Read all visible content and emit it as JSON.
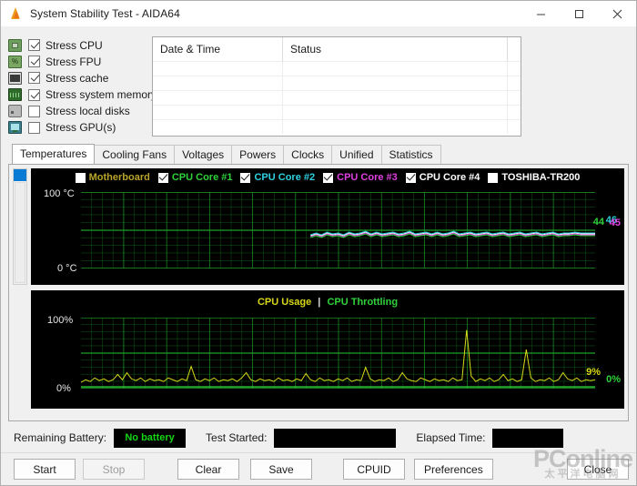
{
  "window": {
    "title": "System Stability Test - AIDA64",
    "icon": "flame-icon",
    "minimize": "–",
    "maximize": "□",
    "close": "✕"
  },
  "stress_options": [
    {
      "label": "Stress CPU",
      "checked": true,
      "icon": "cpu-icon"
    },
    {
      "label": "Stress FPU",
      "checked": true,
      "icon": "fpu-icon"
    },
    {
      "label": "Stress cache",
      "checked": true,
      "icon": "cache-icon"
    },
    {
      "label": "Stress system memory",
      "checked": true,
      "icon": "memory-icon"
    },
    {
      "label": "Stress local disks",
      "checked": false,
      "icon": "disk-icon"
    },
    {
      "label": "Stress GPU(s)",
      "checked": false,
      "icon": "gpu-icon"
    }
  ],
  "log": {
    "columns": [
      "Date & Time",
      "Status"
    ],
    "rows": []
  },
  "tabs": [
    {
      "label": "Temperatures",
      "active": true
    },
    {
      "label": "Cooling Fans",
      "active": false
    },
    {
      "label": "Voltages",
      "active": false
    },
    {
      "label": "Powers",
      "active": false
    },
    {
      "label": "Clocks",
      "active": false
    },
    {
      "label": "Unified",
      "active": false
    },
    {
      "label": "Statistics",
      "active": false
    }
  ],
  "temperature_chart": {
    "legend": [
      {
        "label": "Motherboard",
        "color": "#b8a42a",
        "checked": false
      },
      {
        "label": "CPU Core #1",
        "color": "#2fd23a",
        "checked": true
      },
      {
        "label": "CPU Core #2",
        "color": "#2fd2e0",
        "checked": true
      },
      {
        "label": "CPU Core #3",
        "color": "#e040e0",
        "checked": true
      },
      {
        "label": "CPU Core #4",
        "color": "#ffffff",
        "checked": true
      },
      {
        "label": "TOSHIBA-TR200",
        "color": "#ffffff",
        "checked": false
      }
    ],
    "y_top": "100 °C",
    "y_bottom": "0 °C",
    "readouts": [
      {
        "value": "44",
        "color": "#2fd23a"
      },
      {
        "value": "46",
        "color": "#2fd2e0"
      },
      {
        "value": "45",
        "color": "#e040e0"
      }
    ]
  },
  "usage_chart": {
    "title_usage": "CPU Usage",
    "title_sep": "|",
    "title_throttling": "CPU Throttling",
    "color_usage": "#d8d818",
    "color_throttling": "#2fd23a",
    "y_top": "100%",
    "y_bottom": "0%",
    "readouts": [
      {
        "value": "9%",
        "color": "#d8d818"
      },
      {
        "value": "0%",
        "color": "#2fd23a"
      }
    ]
  },
  "status": {
    "battery_label": "Remaining Battery:",
    "battery_value": "No battery",
    "started_label": "Test Started:",
    "started_value": "",
    "elapsed_label": "Elapsed Time:",
    "elapsed_value": ""
  },
  "buttons": [
    {
      "label": "Start",
      "disabled": false
    },
    {
      "label": "Stop",
      "disabled": true
    },
    {
      "label": "Clear",
      "disabled": false
    },
    {
      "label": "Save",
      "disabled": false
    },
    {
      "label": "CPUID",
      "disabled": false
    },
    {
      "label": "Preferences",
      "disabled": false
    }
  ],
  "close_button": {
    "label": "Close"
  },
  "watermark": {
    "main": "PConline",
    "sub": "太平洋电脑网"
  },
  "chart_data": {
    "type": "line",
    "charts": [
      {
        "name": "temperatures",
        "ylabel": "°C",
        "ylim": [
          0,
          100
        ],
        "grid": true,
        "series": [
          {
            "name": "CPU Core #1",
            "color": "#2fd23a",
            "last": 44
          },
          {
            "name": "CPU Core #2",
            "color": "#2fd2e0",
            "last": 46
          },
          {
            "name": "CPU Core #3",
            "color": "#e040e0",
            "last": 45
          },
          {
            "name": "CPU Core #4",
            "color": "#ffffff",
            "last": 45
          }
        ],
        "approx_range": [
          42,
          48
        ]
      },
      {
        "name": "cpu_usage",
        "ylabel": "%",
        "ylim": [
          0,
          100
        ],
        "grid": true,
        "series": [
          {
            "name": "CPU Usage",
            "color": "#d8d818",
            "last": 9
          },
          {
            "name": "CPU Throttling",
            "color": "#2fd23a",
            "last": 0
          }
        ],
        "approx_range": [
          3,
          55
        ]
      }
    ]
  }
}
